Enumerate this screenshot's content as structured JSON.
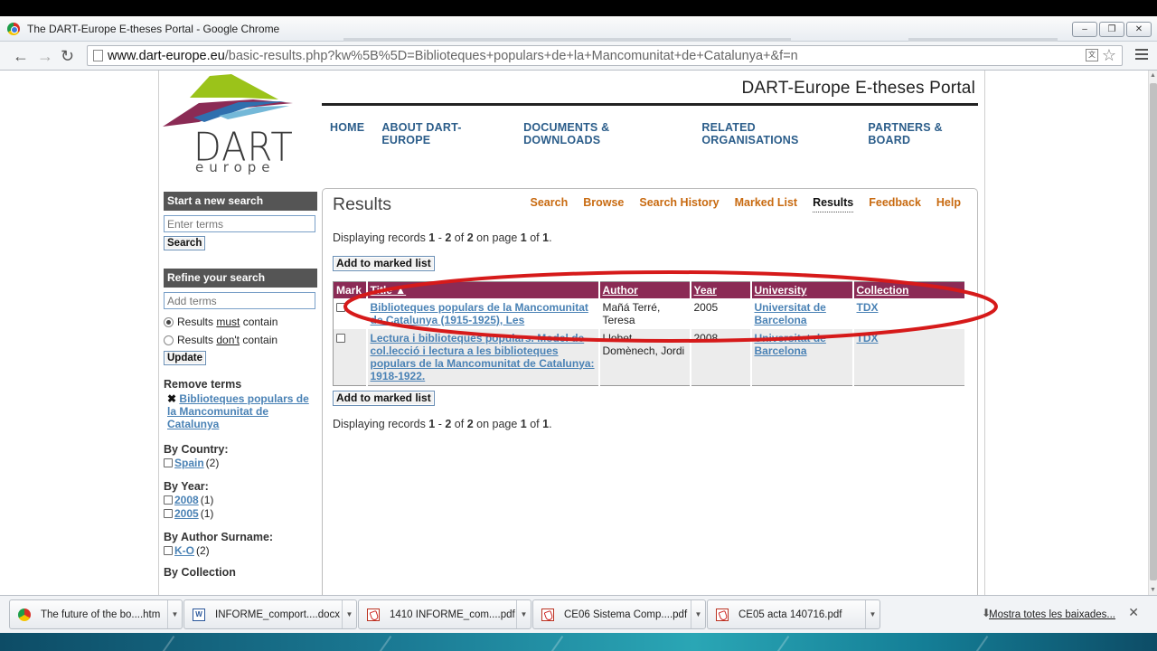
{
  "window": {
    "title": "The DART-Europe E-theses Portal - Google Chrome"
  },
  "browser": {
    "url_host": "www.dart-europe.eu",
    "url_path": "/basic-results.php?kw%5B%5D=Biblioteques+populars+de+la+Mancomunitat+de+Catalunya+&f=n"
  },
  "site": {
    "portal_title": "DART-Europe E-theses Portal",
    "logo_text": "DART",
    "logo_sub": "europe",
    "nav": [
      "HOME",
      "ABOUT DART-EUROPE",
      "DOCUMENTS & DOWNLOADS",
      "RELATED ORGANISATIONS",
      "PARTNERS & BOARD"
    ]
  },
  "sidebar": {
    "new_search_heading": "Start a new search",
    "new_search_placeholder": "Enter terms",
    "search_button": "Search",
    "refine_heading": "Refine your search",
    "refine_placeholder": "Add terms",
    "radio_must_pre": "Results ",
    "radio_must_em": "must",
    "radio_must_post": " contain",
    "radio_dont_pre": "Results ",
    "radio_dont_em": "don't",
    "radio_dont_post": " contain",
    "update_button": "Update",
    "remove_heading": "Remove terms",
    "remove_term": "Biblioteques populars de la Mancomunitat de Catalunya",
    "country_heading": "By Country:",
    "country_items": [
      {
        "label": "Spain",
        "count": "(2)"
      }
    ],
    "year_heading": "By Year:",
    "year_items": [
      {
        "label": "2008",
        "count": "(1)"
      },
      {
        "label": "2005",
        "count": "(1)"
      }
    ],
    "author_heading": "By Author Surname:",
    "author_items": [
      {
        "label": "K-O",
        "count": "(2)"
      }
    ],
    "next_heading_partial": "By Collection"
  },
  "content": {
    "heading": "Results",
    "subnav": [
      "Search",
      "Browse",
      "Search History",
      "Marked List",
      "Results",
      "Feedback",
      "Help"
    ],
    "subnav_active": "Results",
    "displaying": {
      "pre": "Displaying records ",
      "from": "1",
      "dash": " - ",
      "to": "2",
      "of_txt": " of ",
      "total": "2",
      "page_txt": " on page ",
      "page": "1",
      "of2": " of ",
      "pages": "1",
      "end": "."
    },
    "add_button": "Add to marked list",
    "columns": {
      "mark": "Mark",
      "title": "Title ▲",
      "author": "Author",
      "year": "Year",
      "university": "University",
      "collection": "Collection"
    },
    "rows": [
      {
        "title": "Biblioteques populars de la Mancomunitat de Catalunya (1915-1925), Les",
        "author": "Mañá Terré, Teresa",
        "year": "2005",
        "university": "Universitat de Barcelona",
        "collection": "TDX"
      },
      {
        "title": "Lectura i biblioteques populars. Model de col.lecció i lectura a les biblioteques populars de la Mancomunitat de Catalunya: 1918-1922.",
        "author": "Llobet Domènech, Jordi",
        "year": "2008",
        "university": "Universitat de Barcelona",
        "collection": "TDX"
      }
    ]
  },
  "downloads": {
    "items": [
      "The future of the bo....htm",
      "INFORME_comport....docx",
      "1410 INFORME_com....pdf",
      "CE06 Sistema Comp....pdf",
      "CE05 acta 140716.pdf"
    ],
    "show_all": "Mostra totes les baixades..."
  },
  "colors": {
    "table_header": "#8b2b55",
    "nav_blue": "#2b5d8a",
    "subnav_orange": "#c86a10",
    "link_blue": "#4a82b5",
    "annotation_red": "#d61a1a"
  }
}
